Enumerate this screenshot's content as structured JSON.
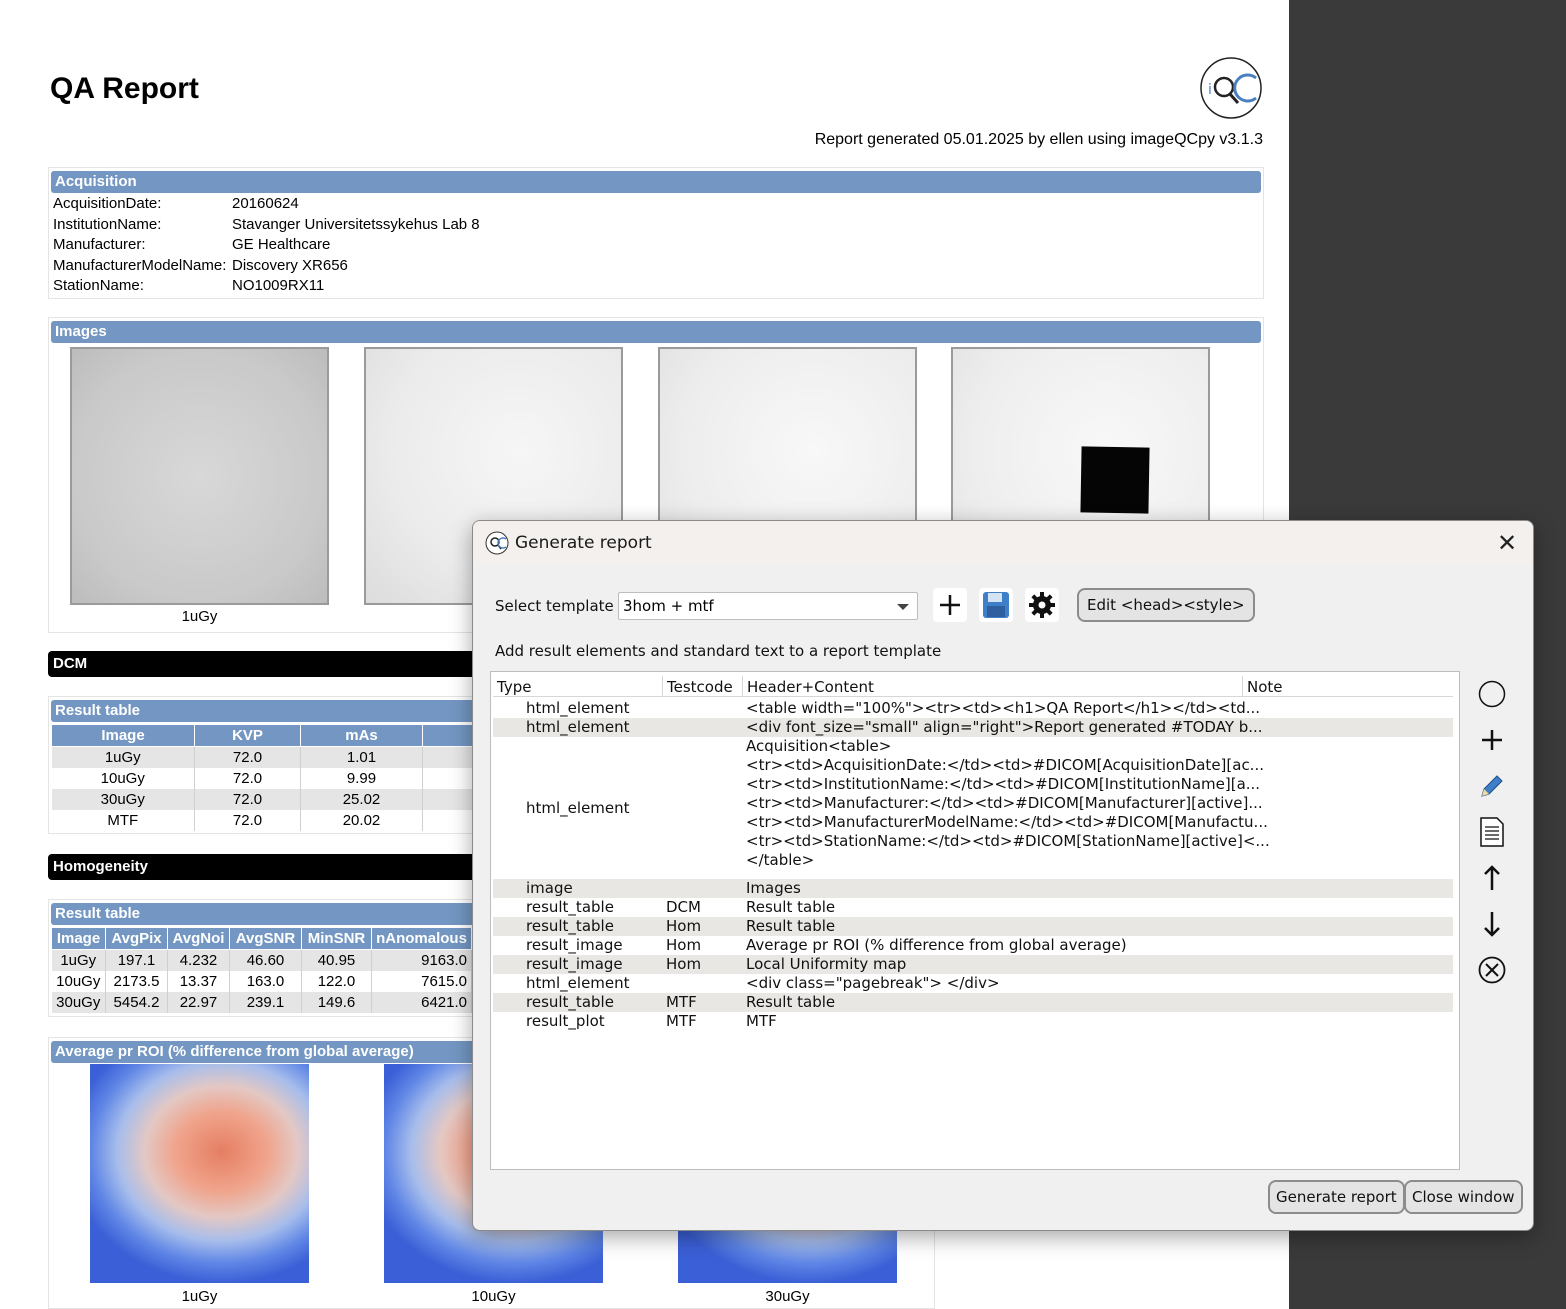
{
  "report": {
    "title": "QA Report",
    "generated_line": "Report generated 05.01.2025 by ellen using imageQCpy v3.1.3",
    "acquisition": {
      "header": "Acquisition",
      "rows": [
        {
          "key": "AcquisitionDate:",
          "value": "20160624"
        },
        {
          "key": "InstitutionName:",
          "value": "Stavanger Universitetssykehus Lab 8"
        },
        {
          "key": "Manufacturer:",
          "value": "GE Healthcare"
        },
        {
          "key": "ManufacturerModelName:",
          "value": "Discovery XR656"
        },
        {
          "key": "StationName:",
          "value": "NO1009RX11"
        }
      ]
    },
    "images": {
      "header": "Images",
      "caption1": "1uGy"
    },
    "dcm": {
      "section": "DCM",
      "table_header": "Result table",
      "columns": [
        "Image",
        "KVP",
        "mAs"
      ],
      "rows": [
        [
          "1uGy",
          "72.0",
          "1.01"
        ],
        [
          "10uGy",
          "72.0",
          "9.99"
        ],
        [
          "30uGy",
          "72.0",
          "25.02"
        ],
        [
          "MTF",
          "72.0",
          "20.02"
        ]
      ]
    },
    "hom": {
      "section": "Homogeneity",
      "table_header": "Result table",
      "columns": [
        "Image",
        "AvgPix",
        "AvgNoi",
        "AvgSNR",
        "MinSNR",
        "nAnomalous"
      ],
      "rows": [
        [
          "1uGy",
          "197.1",
          "4.232",
          "46.60",
          "40.95",
          "9163.0"
        ],
        [
          "10uGy",
          "2173.5",
          "13.37",
          "163.0",
          "122.0",
          "7615.0"
        ],
        [
          "30uGy",
          "5454.2",
          "22.97",
          "239.1",
          "149.6",
          "6421.0"
        ]
      ]
    },
    "roi": {
      "header": "Average pr ROI (% difference from global average)",
      "captions": [
        "1uGy",
        "10uGy",
        "30uGy"
      ]
    }
  },
  "dialog": {
    "title": "Generate report",
    "select_template_label": "Select template",
    "template_value": "3hom + mtf",
    "edit_head_style": "Edit <head><style>",
    "instructions": "Add result elements and standard text to a report template",
    "columns": {
      "type": "Type",
      "testcode": "Testcode",
      "header_content": "Header+Content",
      "note": "Note"
    },
    "rows": [
      {
        "type": "html_element",
        "code": "",
        "content": [
          "<table width=\"100%\"><tr><td><h1>QA Report</h1></td><td..."
        ]
      },
      {
        "type": "html_element",
        "code": "",
        "content": [
          "<div font_size=\"small\" align=\"right\">Report generated #TODAY b..."
        ]
      },
      {
        "type": "html_element",
        "code": "",
        "content": [
          "Acquisition<table>",
          "<tr><td>AcquisitionDate:</td><td>#DICOM[AcquisitionDate][ac...",
          "<tr><td>InstitutionName:</td><td>#DICOM[InstitutionName][a...",
          "<tr><td>Manufacturer:</td><td>#DICOM[Manufacturer][active]...",
          "<tr><td>ManufacturerModelName:</td><td>#DICOM[Manufactu...",
          "<tr><td>StationName:</td><td>#DICOM[StationName][active]<...",
          "</table>"
        ]
      },
      {
        "type": "image",
        "code": "",
        "content": [
          "Images"
        ]
      },
      {
        "type": "result_table",
        "code": "DCM",
        "content": [
          "Result table"
        ]
      },
      {
        "type": "result_table",
        "code": "Hom",
        "content": [
          "Result table"
        ]
      },
      {
        "type": "result_image",
        "code": "Hom",
        "content": [
          "Average pr ROI (% difference from global average)"
        ]
      },
      {
        "type": "result_image",
        "code": "Hom",
        "content": [
          "Local Uniformity map"
        ]
      },
      {
        "type": "html_element",
        "code": "",
        "content": [
          "<div class=\"pagebreak\"> </div>"
        ]
      },
      {
        "type": "result_table",
        "code": "MTF",
        "content": [
          "Result table"
        ]
      },
      {
        "type": "result_plot",
        "code": "MTF",
        "content": [
          "MTF"
        ]
      }
    ],
    "generate_button": "Generate report",
    "close_button": "Close window"
  }
}
